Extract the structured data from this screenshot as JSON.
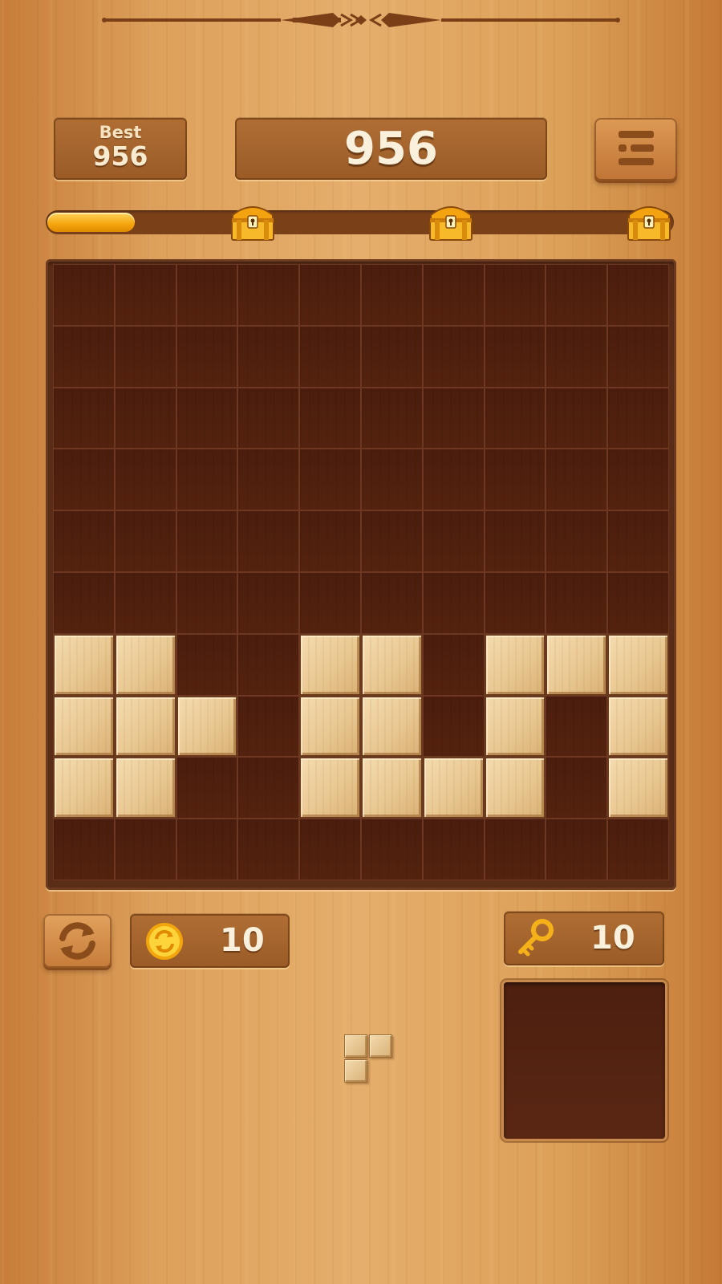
{
  "header": {
    "best_label": "Best",
    "best_value": "956",
    "score": "956"
  },
  "progress": {
    "fill_fraction": 0.14,
    "chests": [
      "treasure-chest-icon",
      "treasure-chest-icon",
      "treasure-chest-icon"
    ]
  },
  "board": {
    "rows": 10,
    "cols": 10,
    "filled_rows": [
      [
        0,
        0,
        0,
        0,
        0,
        0,
        0,
        0,
        0,
        0
      ],
      [
        0,
        0,
        0,
        0,
        0,
        0,
        0,
        0,
        0,
        0
      ],
      [
        0,
        0,
        0,
        0,
        0,
        0,
        0,
        0,
        0,
        0
      ],
      [
        0,
        0,
        0,
        0,
        0,
        0,
        0,
        0,
        0,
        0
      ],
      [
        0,
        0,
        0,
        0,
        0,
        0,
        0,
        0,
        0,
        0
      ],
      [
        0,
        0,
        0,
        0,
        0,
        0,
        0,
        0,
        0,
        0
      ],
      [
        1,
        1,
        0,
        0,
        1,
        1,
        0,
        1,
        1,
        1
      ],
      [
        1,
        1,
        1,
        0,
        1,
        1,
        0,
        1,
        0,
        1
      ],
      [
        1,
        1,
        0,
        0,
        1,
        1,
        1,
        1,
        0,
        1
      ],
      [
        0,
        0,
        0,
        0,
        0,
        0,
        0,
        0,
        0,
        0
      ]
    ]
  },
  "controls": {
    "coins": "10",
    "keys": "10"
  },
  "next_piece": {
    "cells": [
      [
        0,
        0
      ],
      [
        0,
        1
      ],
      [
        1,
        0
      ]
    ]
  },
  "colors": {
    "board": "#4f2313",
    "block": "#e9c892",
    "progress": "#f5a50e"
  }
}
